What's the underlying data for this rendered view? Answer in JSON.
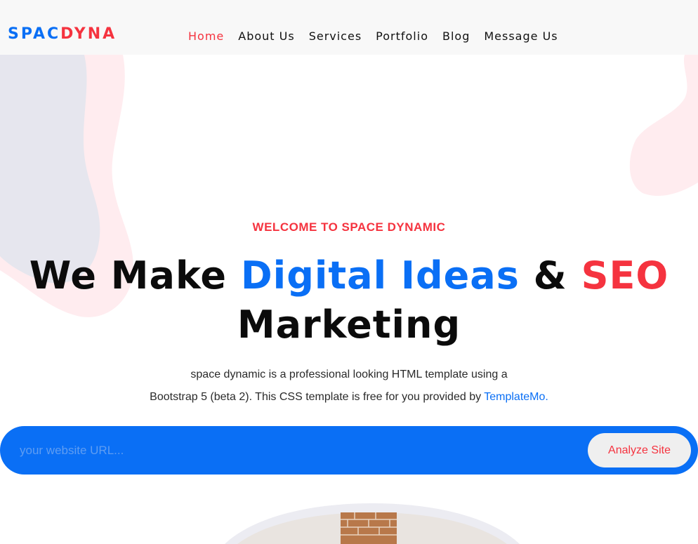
{
  "brand": {
    "part1": "SPAC",
    "part2": "DYNA"
  },
  "nav": {
    "items": [
      {
        "label": "Home",
        "active": true
      },
      {
        "label": "About Us",
        "active": false
      },
      {
        "label": "Services",
        "active": false
      },
      {
        "label": "Portfolio",
        "active": false
      },
      {
        "label": "Blog",
        "active": false
      },
      {
        "label": "Message Us",
        "active": false
      }
    ]
  },
  "hero": {
    "eyebrow": "WELCOME TO SPACE DYNAMIC",
    "headline": {
      "part1": "We Make ",
      "highlight1": "Digital Ideas",
      "part2": " & ",
      "highlight2": "SEO",
      "line2": "Marketing"
    },
    "description": {
      "line1": "space dynamic is a professional looking HTML template using a",
      "line2": "Bootstrap 5 (beta 2). This CSS template is free for you provided by ",
      "link": "TemplateMo."
    }
  },
  "search": {
    "placeholder": "your website URL...",
    "button_label": "Analyze Site"
  },
  "colors": {
    "primary": "#0a6ff5",
    "accent": "#f5333f",
    "topbar": "#f8f8f8",
    "button_bg": "#efefef"
  },
  "icons": [
    "blob-shape-left",
    "blob-shape-right",
    "hero-photo"
  ]
}
